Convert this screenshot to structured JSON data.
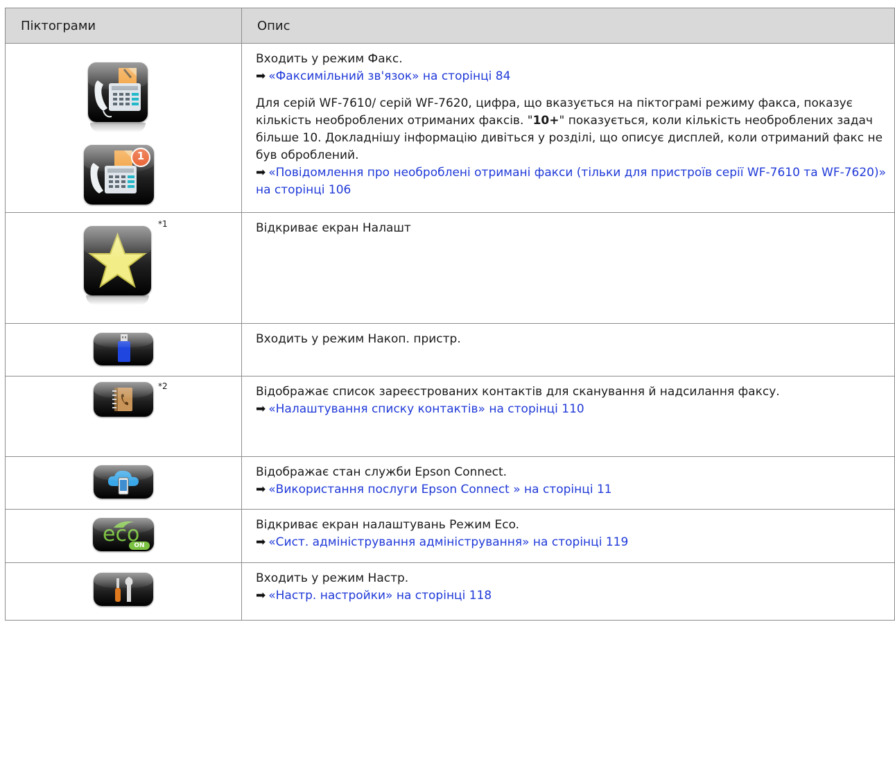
{
  "table": {
    "header": {
      "icons_col": "Піктограми",
      "desc_col": "Опис"
    },
    "rows": [
      {
        "icon": "fax-icon",
        "badge_icon": "fax-unread-icon",
        "badge_value": "1",
        "desc_line1": "Входить у режим Факс.",
        "link1": "«Факсимільний зв'язок» на сторінці 84",
        "para_a": "Для серій WF-7610/ серій WF-7620, цифра, що вказується на піктограмі режиму факса, показує кількість необроблених отриманих факсів. \"",
        "para_bold": "10+",
        "para_b": "\" показується, коли кількість необроблених задач більше 10. Докладнішу інформацію дивіться у розділі, що описує дисплей, коли отриманий факс не був оброблений.",
        "link2": "«Повідомлення про необроблені отримані факси (тільки для пристроїв серії WF-7610 та WF-7620)» на сторінці 106"
      },
      {
        "icon": "favorites-star-icon",
        "footnote": "*1",
        "desc_line1": "Відкриває екран Налашт"
      },
      {
        "icon": "usb-drive-icon",
        "desc_line1": "Входить у режим Накоп. пристр."
      },
      {
        "icon": "contacts-book-icon",
        "footnote": "*2",
        "desc_line1": "Відображає список зареєстрованих контактів для сканування й надсилання факсу.",
        "link1": "«Налаштування списку контактів» на сторінці 110"
      },
      {
        "icon": "cloud-connect-icon",
        "desc_line1": "Відображає стан служби Epson Connect.",
        "link1": "«Використання послуги Epson Connect » на сторінці 11"
      },
      {
        "icon": "eco-mode-icon",
        "icon_text": "eco",
        "icon_badge": "ON",
        "desc_line1": "Відкриває екран налаштувань Режим Eco.",
        "link1": "«Сист. адміністрування адміністрування» на сторінці 119"
      },
      {
        "icon": "setup-tools-icon",
        "desc_line1": "Входить у режим Настр.",
        "link1": "«Настр. настройки» на сторінці 118"
      }
    ]
  },
  "arrow_glyph": "➡",
  "colors": {
    "link": "#1f39d8",
    "header_bg": "#d9d9d9",
    "border": "#8c8c8c",
    "badge": "#e8531e",
    "eco_green": "#7cc242"
  }
}
